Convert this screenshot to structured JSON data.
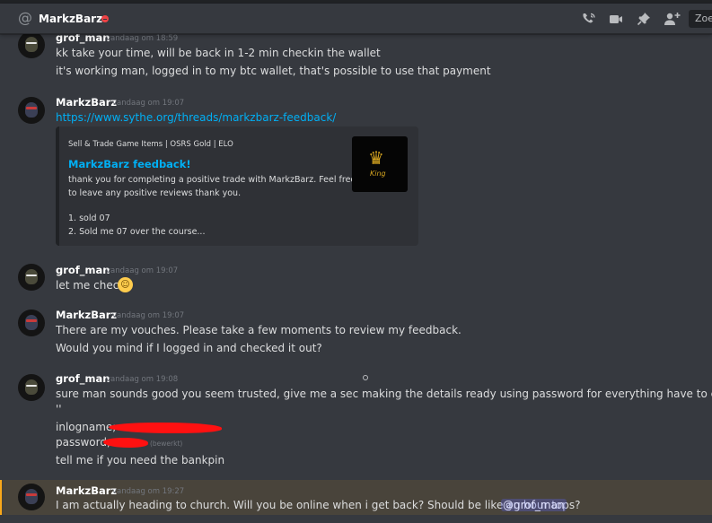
{
  "header": {
    "channel_symbol": "@",
    "title": "MarkzBarz",
    "status": "dnd",
    "search_text": "Zoe"
  },
  "icons": {
    "call": "phone-call-icon",
    "video": "video-icon",
    "pin": "pin-icon",
    "add_member": "add-member-icon"
  },
  "colors": {
    "background": "#36393f",
    "link": "#00aff4",
    "redaction": "#ff1111",
    "highlight_bar": "#faa81a",
    "dnd": "#ed4245"
  },
  "messages": [
    {
      "author": "grof_man",
      "timestamp": "vandaag om 18:59",
      "lines": [
        "kk take your time, will be back in 1-2 min checkin the wallet",
        "it's working man, logged in to my btc wallet, that's possible to use that payment"
      ]
    },
    {
      "author": "MarkzBarz",
      "timestamp": "vandaag om 19:07",
      "link": "https://www.sythe.org/threads/markzbarz-feedback/",
      "embed": {
        "provider": "Sell & Trade Game Items | OSRS Gold | ELO",
        "title": "MarkzBarz feedback!",
        "description": [
          "thank you for completing a positive trade with MarkzBarz. Feel free",
          "to leave any positive reviews thank you.",
          "1. sold 07",
          "2. Sold me 07 over the course..."
        ],
        "thumbnail_text": "King"
      }
    },
    {
      "author": "grof_man",
      "timestamp": "vandaag om 19:07",
      "lines": [
        "let me check"
      ],
      "emoji": "slightly-smiling-face"
    },
    {
      "author": "MarkzBarz",
      "timestamp": "vandaag om 19:07",
      "lines": [
        "There are my vouches. Please take a few moments to review my feedback.",
        "Would you mind if I logged in and checked it out?"
      ]
    },
    {
      "author": "grof_man",
      "timestamp": "vandaag om 19:08",
      "lines": [
        "sure man sounds good you seem trusted, give me a sec making the details ready using password for everything have to change it",
        "''",
        "inlogname;",
        "password;",
        "tell me if you need the bankpin"
      ],
      "edited": "(bewerkt)"
    },
    {
      "author": "MarkzBarz",
      "timestamp": "vandaag om 19:27",
      "lines": [
        "I am actually heading to church. Will you be online when i get back? Should be like an hour tops?"
      ],
      "mention": "@grof_man"
    }
  ]
}
